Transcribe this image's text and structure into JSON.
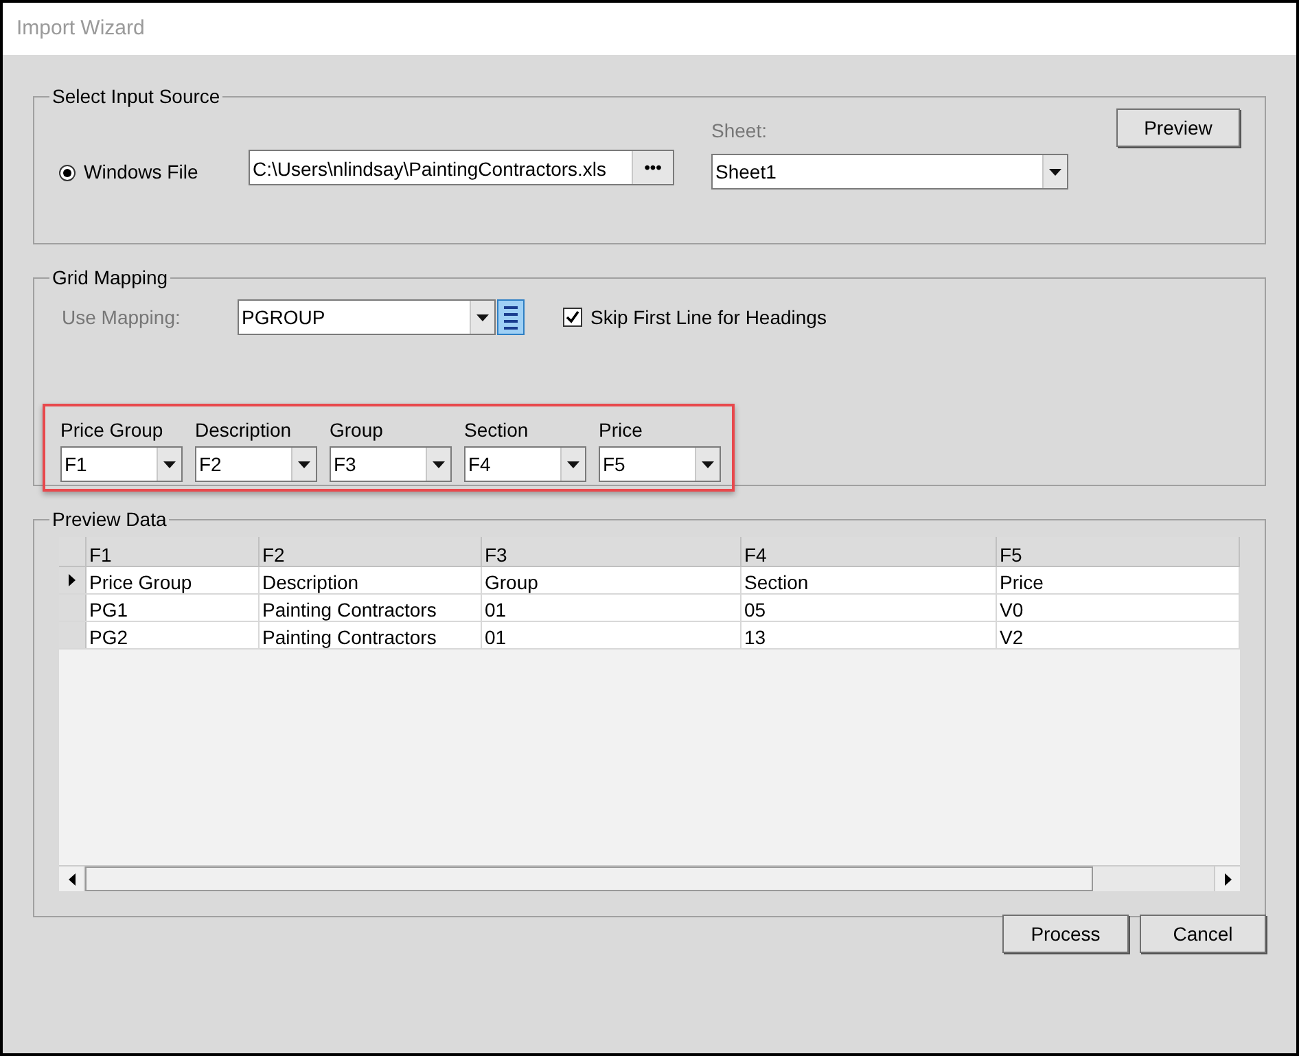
{
  "window": {
    "title": "Import Wizard"
  },
  "input_source": {
    "legend": "Select Input Source",
    "option": {
      "label": "Windows File",
      "selected": true
    },
    "file_path": "C:\\Users\\nlindsay\\PaintingContractors.xls",
    "browse_button": "•••",
    "sheet_label": "Sheet:",
    "sheet_value": "Sheet1",
    "preview_button": "Preview"
  },
  "grid_mapping": {
    "legend": "Grid Mapping",
    "use_mapping_label": "Use Mapping:",
    "mapping_value": "PGROUP",
    "skip_first_line": {
      "label": "Skip First Line for Headings",
      "checked": true
    },
    "fields": [
      {
        "label": "Price Group",
        "value": "F1"
      },
      {
        "label": "Description",
        "value": "F2"
      },
      {
        "label": "Group",
        "value": "F3"
      },
      {
        "label": "Section",
        "value": "F4"
      },
      {
        "label": "Price",
        "value": "F5"
      }
    ]
  },
  "preview_data": {
    "legend": "Preview Data",
    "columns": [
      "F1",
      "F2",
      "F3",
      "F4",
      "F5"
    ],
    "rows": [
      {
        "current": true,
        "cells": [
          "Price Group",
          "Description",
          "Group",
          "Section",
          "Price"
        ]
      },
      {
        "current": false,
        "cells": [
          "PG1",
          "Painting Contractors",
          "01",
          "05",
          "V0"
        ]
      },
      {
        "current": false,
        "cells": [
          "PG2",
          "Painting Contractors",
          "01",
          "13",
          "V2"
        ]
      }
    ]
  },
  "buttons": [
    "Process",
    "Cancel"
  ]
}
